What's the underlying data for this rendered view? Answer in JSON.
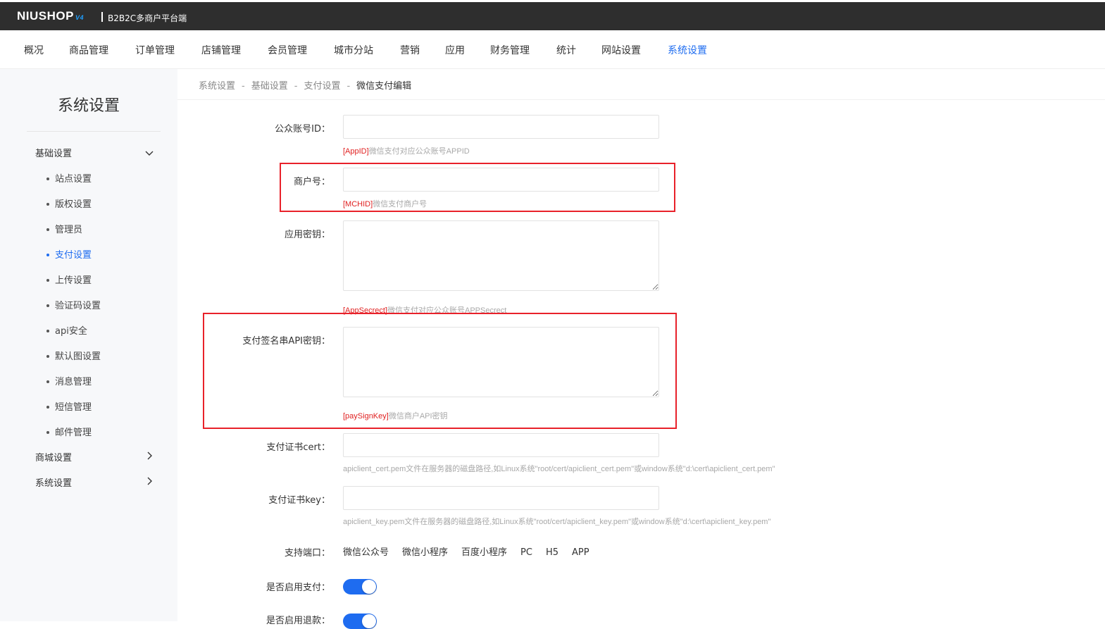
{
  "header": {
    "brand": "NIUSHOP",
    "version": "V4",
    "subtitle": "B2B2C多商户平台端"
  },
  "main_nav": [
    {
      "label": "概况"
    },
    {
      "label": "商品管理"
    },
    {
      "label": "订单管理"
    },
    {
      "label": "店铺管理"
    },
    {
      "label": "会员管理"
    },
    {
      "label": "城市分站"
    },
    {
      "label": "营销"
    },
    {
      "label": "应用"
    },
    {
      "label": "财务管理"
    },
    {
      "label": "统计"
    },
    {
      "label": "网站设置"
    },
    {
      "label": "系统设置",
      "active": true
    }
  ],
  "sidebar": {
    "title": "系统设置",
    "groups": [
      {
        "label": "基础设置",
        "expanded": true,
        "icon": "chevron-down-icon"
      },
      {
        "label": "商城设置",
        "expanded": false,
        "icon": "chevron-right-icon"
      },
      {
        "label": "系统设置",
        "expanded": false,
        "icon": "chevron-right-icon"
      }
    ],
    "items": [
      {
        "label": "站点设置"
      },
      {
        "label": "版权设置"
      },
      {
        "label": "管理员"
      },
      {
        "label": "支付设置",
        "active": true
      },
      {
        "label": "上传设置"
      },
      {
        "label": "验证码设置"
      },
      {
        "label": "api安全"
      },
      {
        "label": "默认图设置"
      },
      {
        "label": "消息管理"
      },
      {
        "label": "短信管理"
      },
      {
        "label": "邮件管理"
      }
    ]
  },
  "breadcrumb": {
    "items": [
      "系统设置",
      "基础设置",
      "支付设置",
      "微信支付编辑"
    ],
    "separator": "-"
  },
  "form": {
    "appid": {
      "label": "公众账号ID：",
      "value": "",
      "hint_key": "[AppID]",
      "hint_text": "微信支付对应公众账号APPID"
    },
    "mchid": {
      "label": "商户号：",
      "value": "",
      "hint_key": "[MCHID]",
      "hint_text": "微信支付商户号"
    },
    "appsecret": {
      "label": "应用密钥：",
      "value": "",
      "hint_key": "[AppSecrect]",
      "hint_text": "微信支付对应公众账号APPSecrect"
    },
    "paysignkey": {
      "label": "支付签名串API密钥：",
      "value": "",
      "hint_key": "[paySignKey]",
      "hint_text": "微信商户API密钥"
    },
    "cert": {
      "label": "支付证书cert：",
      "value": "",
      "hint": "apiclient_cert.pem文件在服务器的磁盘路径,如Linux系统\"root/cert/apiclient_cert.pem\"或window系统\"d:\\cert\\apiclient_cert.pem\""
    },
    "key": {
      "label": "支付证书key：",
      "value": "",
      "hint": "apiclient_key.pem文件在服务器的磁盘路径,如Linux系统\"root/cert/apiclient_key.pem\"或window系统\"d:\\cert\\apiclient_key.pem\""
    },
    "ports": {
      "label": "支持端口：",
      "items": [
        "微信公众号",
        "微信小程序",
        "百度小程序",
        "PC",
        "H5",
        "APP"
      ]
    },
    "enable_pay": {
      "label": "是否启用支付：",
      "on": true
    },
    "enable_refund": {
      "label": "是否启用退款：",
      "on": true
    }
  },
  "colors": {
    "accent": "#1e6cf0",
    "highlight": "#e8212a",
    "topbar": "#2e2e2e"
  }
}
